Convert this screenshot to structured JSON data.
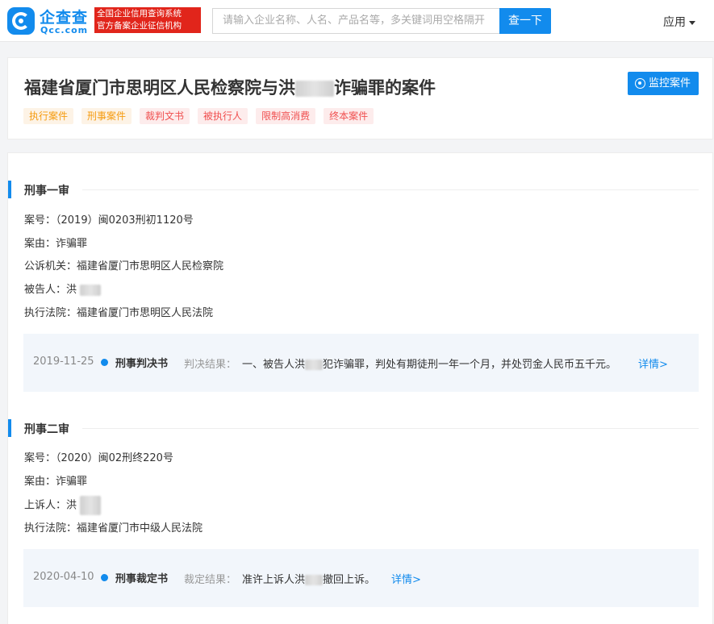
{
  "header": {
    "logo_cn": "企查查",
    "logo_en": "Qcc.com",
    "badge_line1": "全国企业信用查询系统",
    "badge_line2": "官方备案企业征信机构",
    "search_placeholder": "请输入企业名称、人名、产品名等，多关键词用空格隔开",
    "search_button": "查一下",
    "apps_label": "应用"
  },
  "case": {
    "title_prefix": "福建省厦门市思明区人民检察院与洪",
    "title_suffix": "诈骗罪的案件",
    "monitor_button": "监控案件",
    "tags": [
      {
        "label": "执行案件",
        "color": "#f59b0f"
      },
      {
        "label": "刑事案件",
        "color": "#f59b0f"
      },
      {
        "label": "裁判文书",
        "color": "#f04f4f"
      },
      {
        "label": "被执行人",
        "color": "#f04f4f"
      },
      {
        "label": "限制高消费",
        "color": "#f04f4f"
      },
      {
        "label": "终本案件",
        "color": "#f04f4f"
      }
    ]
  },
  "sections": [
    {
      "heading": "刑事一审",
      "fields": [
        {
          "label": "案号：",
          "value": "（2019）闽0203刑初1120号"
        },
        {
          "label": "案由：",
          "value": "诈骗罪"
        },
        {
          "label": "公诉机关：",
          "value": "福建省厦门市思明区人民检察院"
        },
        {
          "label": "被告人：",
          "value": "洪"
        },
        {
          "label": "执行法院：",
          "value": "福建省厦门市思明区人民法院"
        }
      ],
      "doc": {
        "date": "2019-11-25",
        "type": "刑事判决书",
        "result_label": "判决结果：",
        "result_prefix": "一、被告人洪",
        "result_suffix": "犯诈骗罪，判处有期徒刑一年一个月，并处罚金人民币五千元。",
        "more": "详情>"
      }
    },
    {
      "heading": "刑事二审",
      "fields": [
        {
          "label": "案号：",
          "value": "（2020）闽02刑终220号"
        },
        {
          "label": "案由：",
          "value": "诈骗罪"
        },
        {
          "label": "上诉人：",
          "value": "洪"
        },
        {
          "label": "执行法院：",
          "value": "福建省厦门市中级人民法院"
        }
      ],
      "doc": {
        "date": "2020-04-10",
        "type": "刑事裁定书",
        "result_label": "裁定结果：",
        "result_prefix": "准许上诉人洪",
        "result_suffix": "撤回上诉。",
        "more": "详情>"
      }
    }
  ],
  "colors": {
    "accent": "#128bed",
    "brand_red": "#e1251b"
  }
}
